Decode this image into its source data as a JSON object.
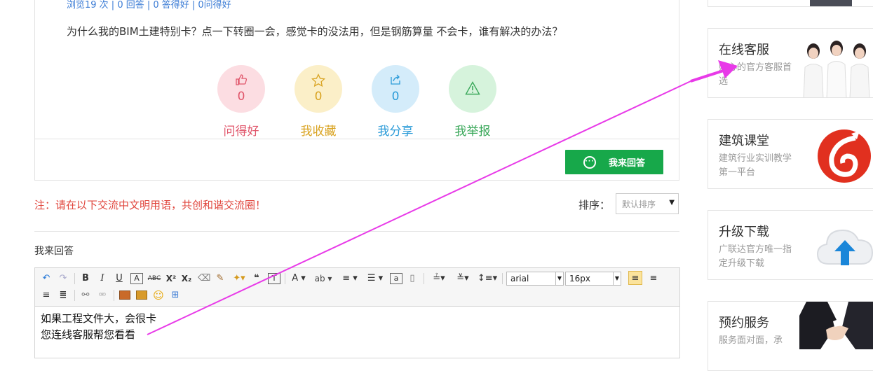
{
  "question": {
    "stats": "浏览19 次 | 0 回答 | 0 答得好 | 0问得好",
    "text": "为什么我的BIM土建特别卡？点一下转圈一会，感觉卡的没法用，但是钢筋算量 不会卡，谁有解决的办法？",
    "actions": [
      {
        "label": "问得好",
        "count": "0",
        "icon": "thumbs-up-icon",
        "color": "#e0556a",
        "bg": "#fcdde2"
      },
      {
        "label": "我收藏",
        "count": "0",
        "icon": "star-icon",
        "color": "#d9a321",
        "bg": "#fbefc8"
      },
      {
        "label": "我分享",
        "count": "0",
        "icon": "share-icon",
        "color": "#2b9bd8",
        "bg": "#d4ecfa"
      },
      {
        "label": "我举报",
        "count": "0",
        "icon": "warning-icon",
        "color": "#3aa85a",
        "bg": "#d6f3dc"
      }
    ],
    "answer_button": "我来回答"
  },
  "notice": "注：请在以下交流中文明用语，共创和谐交流圈！",
  "sort": {
    "label": "排序：",
    "value": "默认排序"
  },
  "reply_title": "我来回答",
  "editor": {
    "font_family": "arial",
    "font_size": "16px",
    "lines": [
      "如果工程文件大，会很卡",
      "您连线客服帮您看看"
    ]
  },
  "sidebar": [
    {
      "title": "在线客服",
      "desc": "贴心的官方客服首选",
      "icon": "customer-service-staff-image"
    },
    {
      "title": "建筑课堂",
      "desc": "建筑行业实训教学第一平台",
      "icon": "classroom-logo-icon"
    },
    {
      "title": "升级下载",
      "desc": "广联达官方唯一指定升级下载",
      "icon": "cloud-upload-icon"
    },
    {
      "title": "预约服务",
      "desc": "服务面对面，承",
      "icon": "handshake-image"
    }
  ],
  "colors": {
    "accent_green": "#17a84a",
    "notice_red": "#e0463d",
    "annotation": "#e83ae8"
  }
}
